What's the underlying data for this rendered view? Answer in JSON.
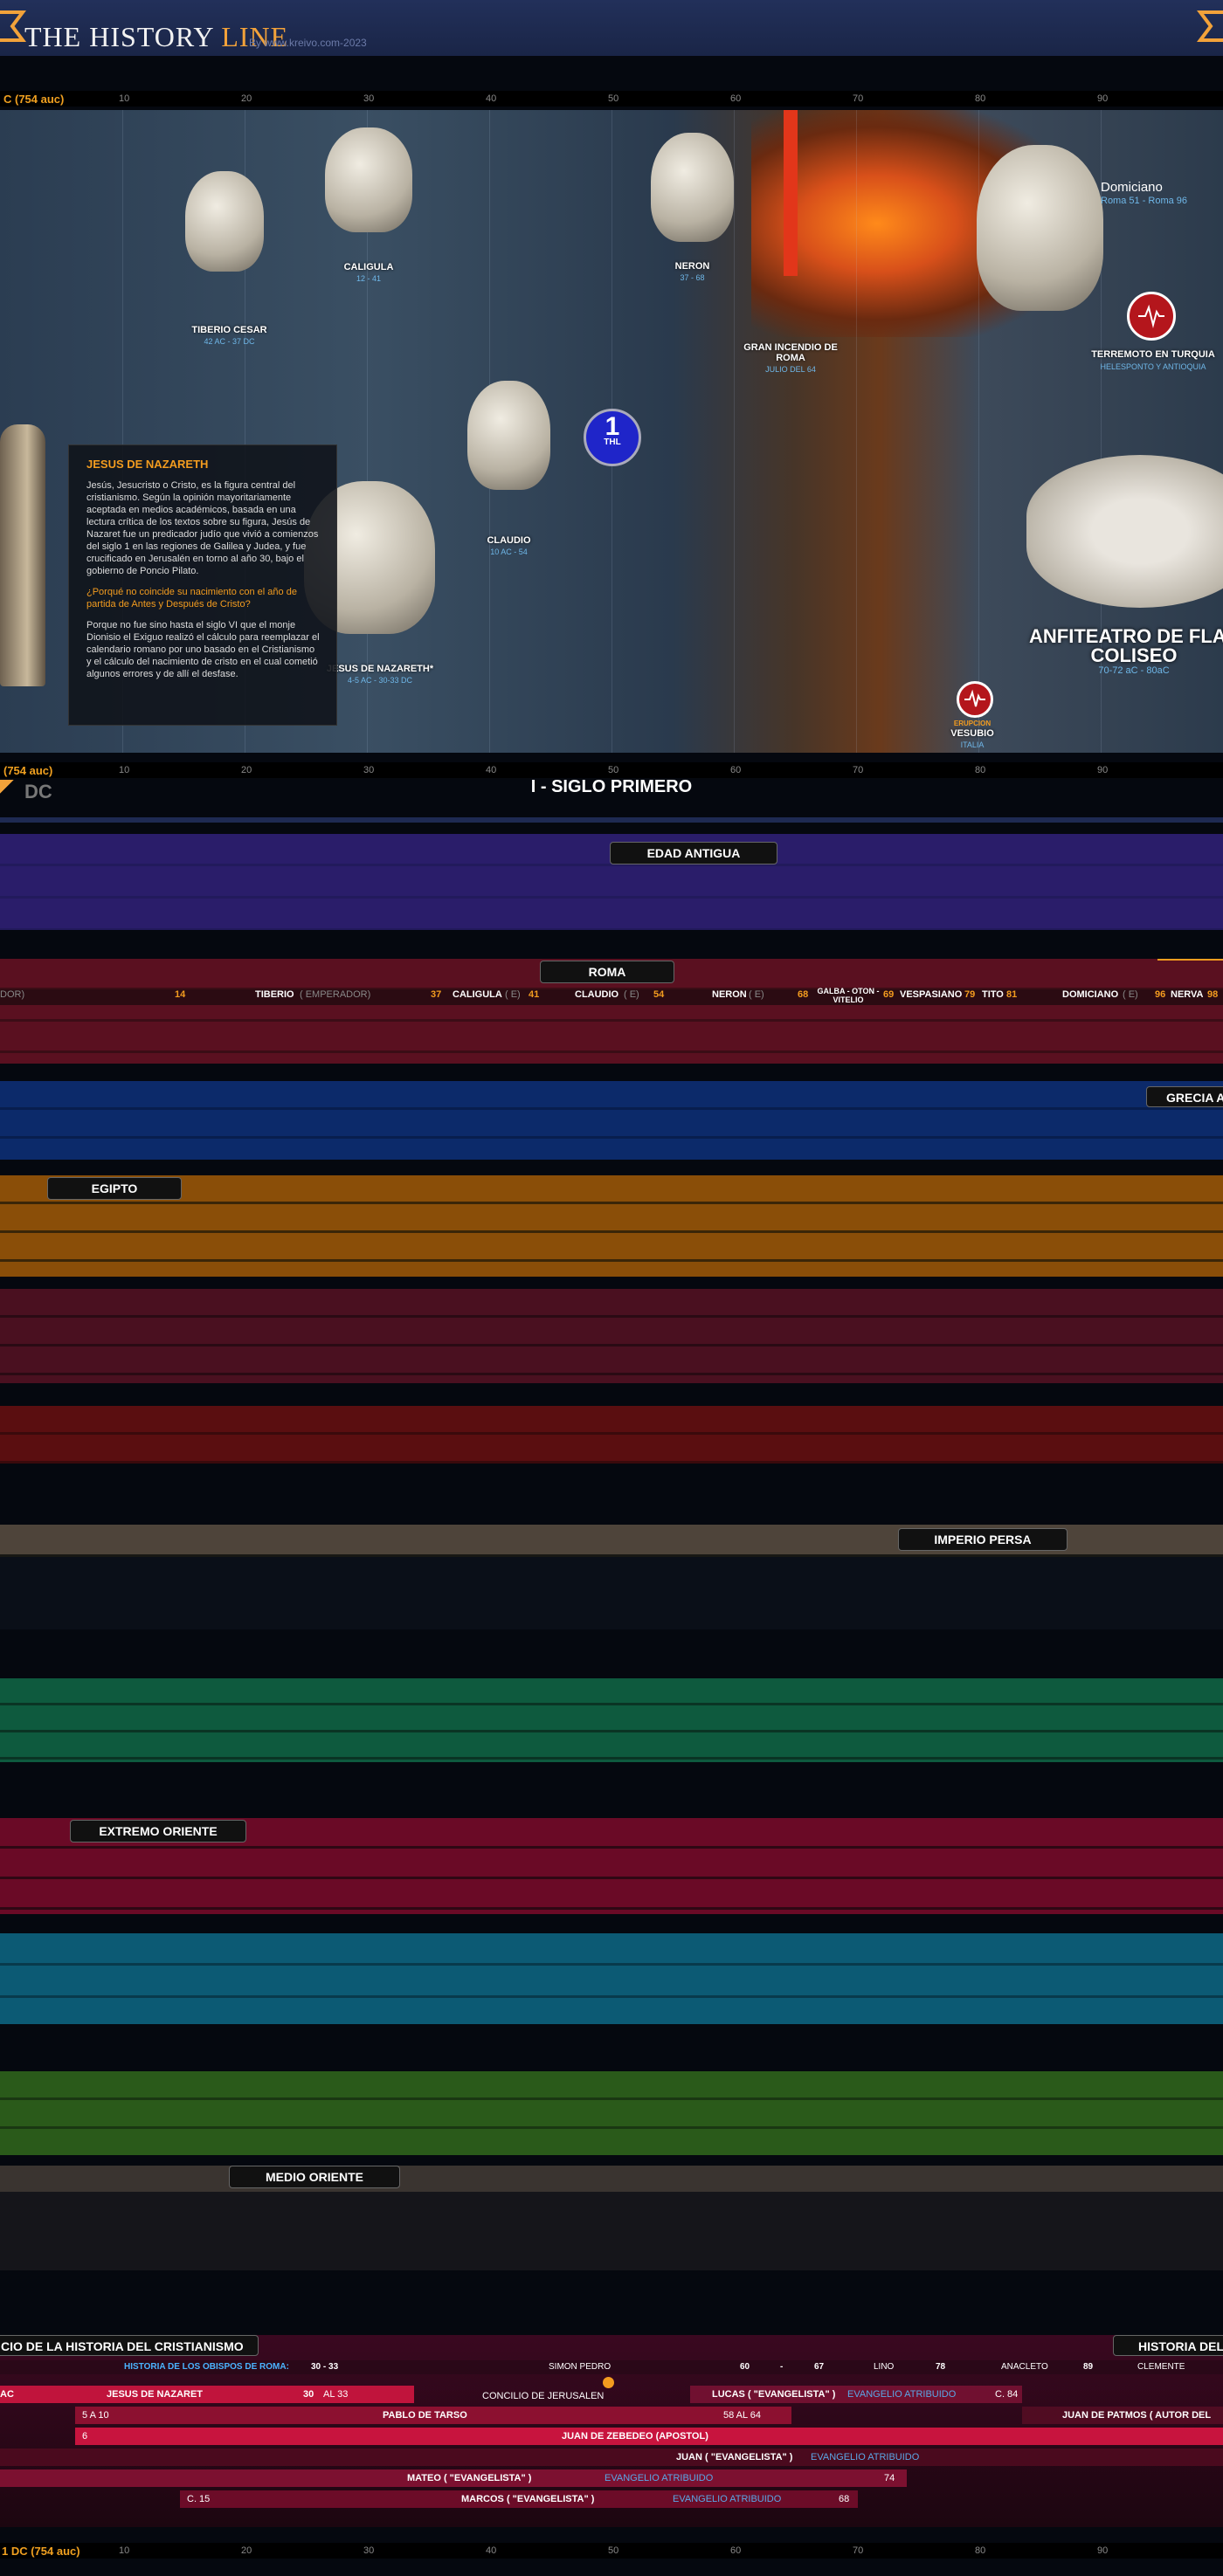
{
  "header": {
    "logo_main": "THE HISTORY ",
    "logo_accent": "LINE",
    "byline": "By www.kreivo.com-2023"
  },
  "ruler": {
    "era_label": "1 DC (754 auc)",
    "era_short": "C (754 auc)",
    "era_short2": "(754 auc)",
    "ticks": [
      "10",
      "20",
      "30",
      "40",
      "50",
      "60",
      "70",
      "80",
      "90"
    ]
  },
  "people": [
    {
      "name": "TIBERIO CESAR",
      "dates": "42 AC - 37 DC"
    },
    {
      "name": "CALIGULA",
      "dates": "12 - 41"
    },
    {
      "name": "NERON",
      "dates": "37 - 68"
    },
    {
      "name": "CLAUDIO",
      "dates": "10 AC - 54"
    },
    {
      "name": "JESUS DE NAZARETH*",
      "dates": "4-5 AC - 30-33 DC"
    }
  ],
  "events": {
    "domiciano_name": "Domiciano",
    "domiciano_dates": "Roma 51 - Roma 96",
    "gran_incendio": "GRAN INCENDIO DE ROMA",
    "gran_incendio_date": "JULIO DEL 64",
    "terremoto": "TERREMOTO EN TURQUIA",
    "terremoto_place": "HELESPONTO Y ANTIOQUIA",
    "anfiteatro_1": "ANFITEATRO DE FLAV",
    "anfiteatro_2": "COLISEO",
    "anfiteatro_dates": "70-72 aC - 80aC",
    "erupcion": "ERUPCION",
    "vesubio": "VESUBIO",
    "italia": "ITALIA",
    "thl_num": "1",
    "thl_label": "THL"
  },
  "jesus_box": {
    "title": "JESUS DE NAZARETH",
    "p1": "Jesús, Jesucristo o Cristo, es la figura central del cristianismo. Según la opinión mayoritariamente aceptada en medios académicos, basada en una lectura crítica de los textos sobre su figura, Jesús de Nazaret fue un predicador judío que vivió a comienzos del siglo 1 en las regiones de Galilea y Judea, y fue crucificado en Jerusalén en torno al año 30, bajo el gobierno de Poncio Pilato.",
    "q": "¿Porqué no coincide su nacimiento con el año de partida de Antes y Después de Cristo?",
    "p2": "Porque no fue sino hasta el siglo VI que el monje Dionisio el Exiguo realizó el cálculo para reemplazar el calendario romano por uno basado en el Cristianismo y el cálculo del nacimiento de cristo en el cual cometió algunos errores y de allí el desfase."
  },
  "section": {
    "dc": "DC",
    "century": "I - SIGLO PRIMERO"
  },
  "bands": {
    "edad_antigua": "EDAD ANTIGUA",
    "roma": "ROMA",
    "grecia": "GRECIA A",
    "egipto": "EGIPTO",
    "imperio_persa": "IMPERIO PERSA",
    "extremo_oriente": "EXTREMO ORIENTE",
    "medio_oriente": "MEDIO ORIENTE",
    "cristianismo_left": "CIO DE LA HISTORIA DEL CRISTIANISMO",
    "cristianismo_right": "HISTORIA DEL"
  },
  "roma_row": [
    {
      "t": "DOR)",
      "c": "dim"
    },
    {
      "t": "14",
      "c": "yr"
    },
    {
      "t": "TIBERIO",
      "c": ""
    },
    {
      "t": "( EMPERADOR)",
      "c": "dim"
    },
    {
      "t": "37",
      "c": "yr"
    },
    {
      "t": "CALIGULA",
      "c": ""
    },
    {
      "t": "( E)",
      "c": "dim"
    },
    {
      "t": "41",
      "c": "yr"
    },
    {
      "t": "CLAUDIO",
      "c": ""
    },
    {
      "t": "( E)",
      "c": "dim"
    },
    {
      "t": "54",
      "c": "yr"
    },
    {
      "t": "NERON",
      "c": ""
    },
    {
      "t": "( E)",
      "c": "dim"
    },
    {
      "t": "68",
      "c": "yr"
    },
    {
      "t": "GALBA - OTON - VITELIO",
      "c": ""
    },
    {
      "t": "69",
      "c": "yr"
    },
    {
      "t": "VESPASIANO",
      "c": ""
    },
    {
      "t": "79",
      "c": "yr"
    },
    {
      "t": "TITO",
      "c": ""
    },
    {
      "t": "81",
      "c": "yr"
    },
    {
      "t": "DOMICIANO",
      "c": ""
    },
    {
      "t": "( E)",
      "c": "dim"
    },
    {
      "t": "96",
      "c": "yr"
    },
    {
      "t": "NERVA",
      "c": ""
    },
    {
      "t": "98",
      "c": "yr"
    }
  ],
  "christ": {
    "obispos_label": "HISTORIA DE LOS OBISPOS DE ROMA:",
    "obispos_years": "30 - 33",
    "simon": "SIMON PEDRO",
    "s60": "60",
    "dash": "-",
    "s67": "67",
    "lino": "LINO",
    "s78": "78",
    "anacleto": "ANACLETO",
    "s89": "89",
    "clemente": "CLEMENTE",
    "ac": "AC",
    "jesus": "JESUS DE NAZARET",
    "j30": "30",
    "al33": "AL 33",
    "concilio": "CONCILIO DE JERUSALEN",
    "lucas": "LUCAS ( \"EVANGELISTA\" )",
    "evang": "EVANGELIO ATRIBUIDO",
    "c84": "C. 84",
    "a5": "5  A 10",
    "pablo": "PABLO DE TARSO",
    "p58": "58  AL  64",
    "patmos": "JUAN DE PATMOS ( AUTOR DEL",
    "n6": "6",
    "zebedeo": "JUAN DE ZEBEDEO (APOSTOL)",
    "juan": "JUAN ( \"EVANGELISTA\" )",
    "mateo": "MATEO ( \"EVANGELISTA\" )",
    "m74": "74",
    "c15": "C. 15",
    "marcos": "MARCOS ( \"EVANGELISTA\" )",
    "m68": "68"
  }
}
